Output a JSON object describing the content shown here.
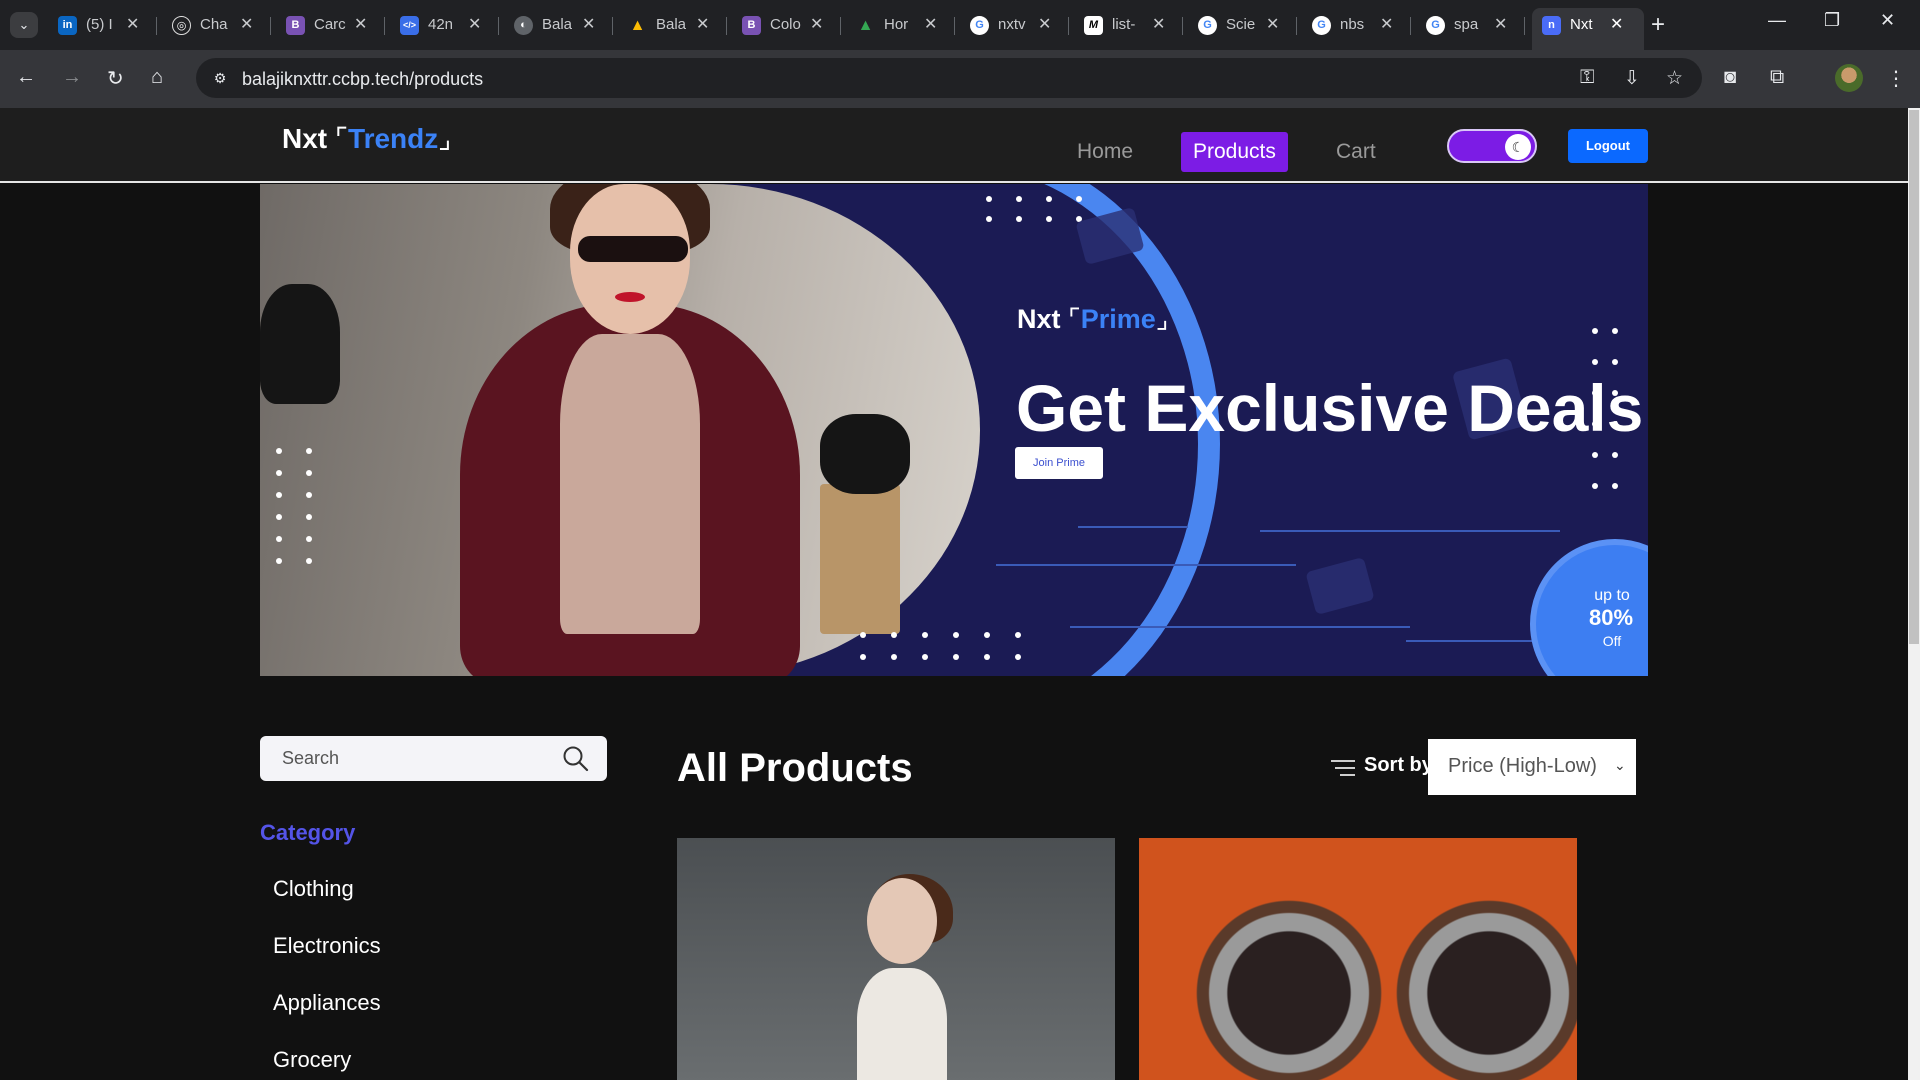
{
  "browser": {
    "tabs": [
      {
        "favicon": "linkedin-icon",
        "title": "(5) I"
      },
      {
        "favicon": "chatgpt-icon",
        "title": "Cha"
      },
      {
        "favicon": "bootstrap-icon",
        "title": "Carc"
      },
      {
        "favicon": "code-icon",
        "title": "42n"
      },
      {
        "favicon": "globe-icon",
        "title": "Bala"
      },
      {
        "favicon": "drive-icon",
        "title": "Bala"
      },
      {
        "favicon": "bootstrap-icon",
        "title": "Colo"
      },
      {
        "favicon": "drive-icon",
        "title": "Hor"
      },
      {
        "favicon": "google-icon",
        "title": "nxtv"
      },
      {
        "favicon": "medium-icon",
        "title": "list-"
      },
      {
        "favicon": "google-icon",
        "title": "Scie"
      },
      {
        "favicon": "google-icon",
        "title": "nbs"
      },
      {
        "favicon": "google-icon",
        "title": "spa"
      },
      {
        "favicon": "nxt-icon",
        "title": "Nxt"
      }
    ],
    "url": "balajiknxttr.ccbp.tech/products"
  },
  "nav": {
    "logo_main": "Nxt",
    "logo_accent": "Trendz",
    "links": [
      "Home",
      "Products",
      "Cart"
    ],
    "active_link": "Products",
    "logout_label": "Logout"
  },
  "banner": {
    "prime_main": "Nxt",
    "prime_accent": "Prime",
    "headline": "Get Exclusive Deals",
    "cta": "Join Prime",
    "offer_line1": "up to",
    "offer_line2": "80%",
    "offer_line3": "Off"
  },
  "sidebar": {
    "search_placeholder": "Search",
    "category_heading": "Category",
    "categories": [
      "Clothing",
      "Electronics",
      "Appliances",
      "Grocery"
    ]
  },
  "products": {
    "heading": "All Products",
    "sort_label": "Sort by",
    "sort_value": "Price (High-Low)"
  },
  "colors": {
    "accent": "#7c1ce5",
    "brand_blue": "#3b82f6",
    "logout_blue": "#0b69ff",
    "banner_bg": "#1b1b54",
    "category_heading": "#5454e8"
  }
}
